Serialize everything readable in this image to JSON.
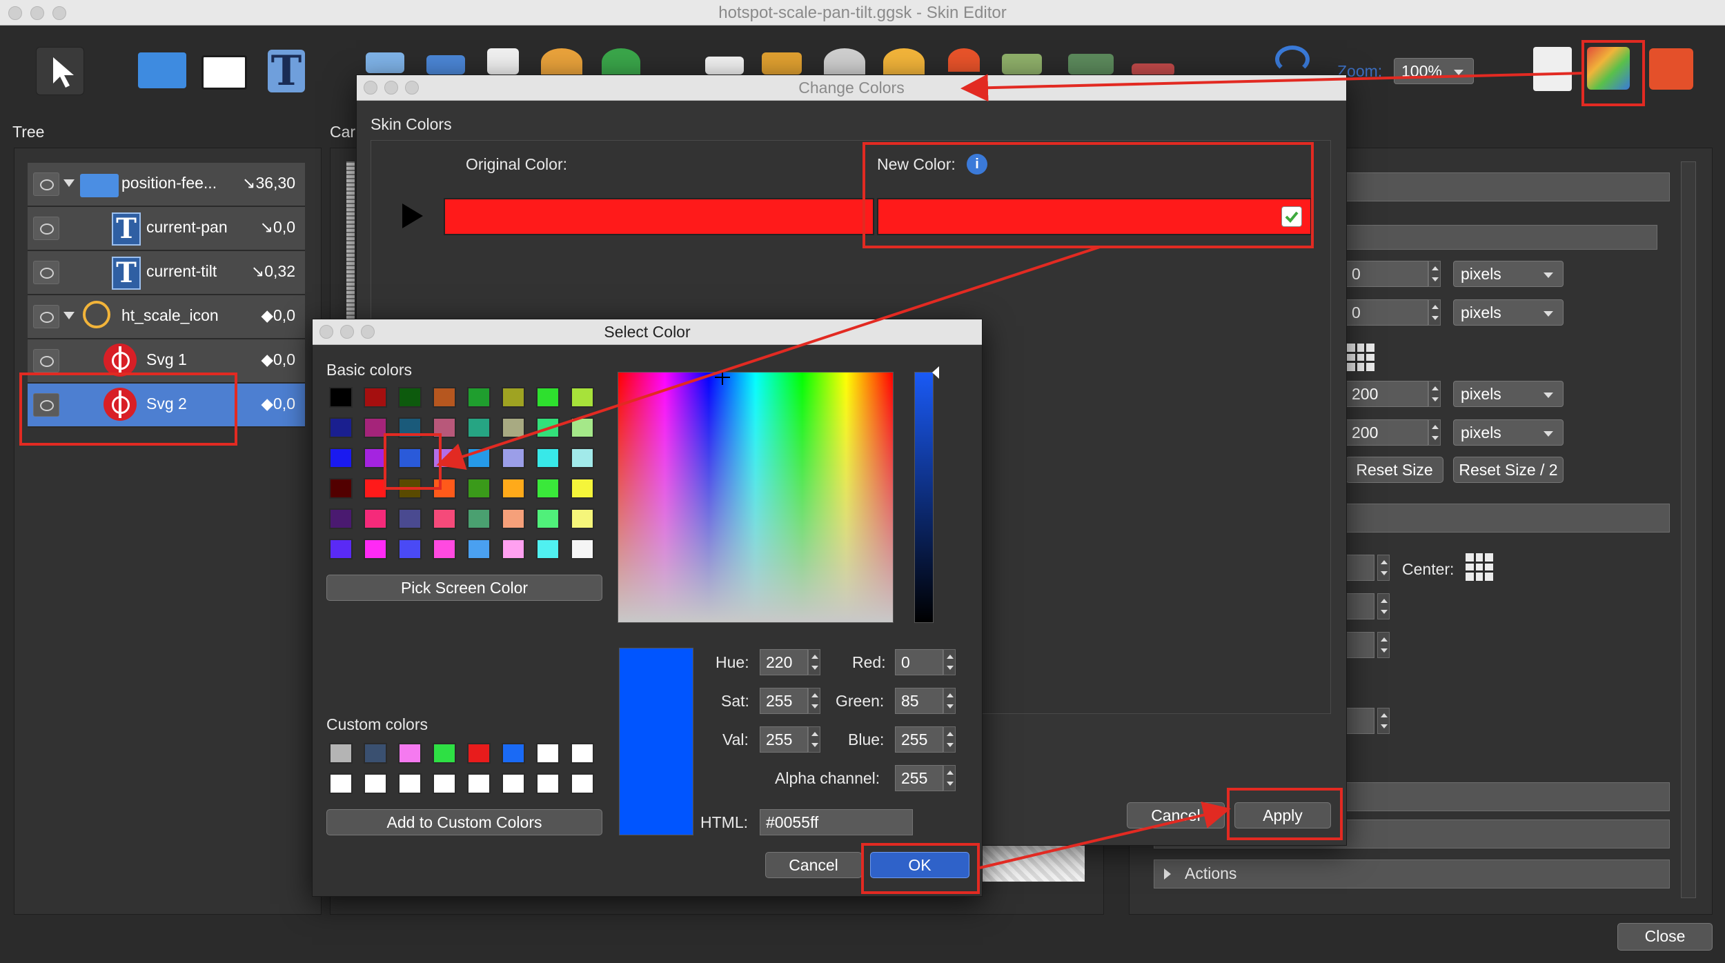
{
  "window": {
    "title": "hotspot-scale-pan-tilt.ggsk - Skin Editor"
  },
  "toolbar": {
    "zoom_label": "Zoom:",
    "zoom_value": "100%"
  },
  "tree": {
    "title": "Tree",
    "nodes": [
      {
        "label": "position-fee...",
        "value": "↘36,30"
      },
      {
        "label": "current-pan",
        "value": "↘0,0"
      },
      {
        "label": "current-tilt",
        "value": "↘0,32"
      },
      {
        "label": "ht_scale_icon",
        "value": "◆0,0"
      },
      {
        "label": "Svg 1",
        "value": "◆0,0"
      },
      {
        "label": "Svg 2",
        "value": "◆0,0"
      }
    ]
  },
  "canvas": {
    "title_partial": "Car"
  },
  "properties": {
    "x_value": "0",
    "y_value": "0",
    "width_value": "200",
    "height_value": "200",
    "unit": "pixels",
    "reset_size": "Reset Size",
    "reset_size_half": "Reset Size / 2",
    "center_label": "Center:",
    "actions_label": "Actions",
    "close": "Close"
  },
  "change_colors": {
    "title": "Change Colors",
    "group": "Skin Colors",
    "original_label": "Original Color:",
    "new_label": "New Color:",
    "original_color": "#ff1a1a",
    "new_color": "#ff1a1a",
    "cancel": "Cancel",
    "apply": "Apply"
  },
  "select_color": {
    "title": "Select Color",
    "basic_label": "Basic colors",
    "basic_colors": [
      "#000000",
      "#a50f0f",
      "#0d5a0d",
      "#b6571f",
      "#1f9e2e",
      "#9fa322",
      "#2ee02e",
      "#a7e23a",
      "#1a1f8f",
      "#a5247a",
      "#1a5a7a",
      "#b8587a",
      "#26a583",
      "#a8aa82",
      "#33e07a",
      "#a5e889",
      "#1a1af0",
      "#a424e0",
      "#2a5ad9",
      "#b36ee8",
      "#269ae8",
      "#9b9ee8",
      "#38e8e8",
      "#a2eaea",
      "#520000",
      "#ff1a1a",
      "#5a4a00",
      "#ff5a1a",
      "#3a9a1a",
      "#ffaa1a",
      "#3ae83a",
      "#f5f53a",
      "#4a1a70",
      "#f52a7a",
      "#4a4a90",
      "#f54a7a",
      "#4aa070",
      "#f5a07a",
      "#50f07a",
      "#f5f57a",
      "#5a2af5",
      "#ff2af5",
      "#4a4af5",
      "#ff4ae0",
      "#4aa0f0",
      "#ffa0f0",
      "#50f0f0",
      "#f5f5f5"
    ],
    "pick_screen": "Pick Screen Color",
    "custom_label": "Custom colors",
    "custom_colors": [
      "#b4b4b4",
      "#3a5070",
      "#f57af0",
      "#2ee044",
      "#e81c1c",
      "#1a6af5",
      "#ffffff",
      "#ffffff",
      "#ffffff",
      "#ffffff",
      "#ffffff",
      "#ffffff",
      "#ffffff",
      "#ffffff",
      "#ffffff",
      "#ffffff"
    ],
    "add_custom": "Add to Custom Colors",
    "hue_label": "Hue:",
    "hue": "220",
    "sat_label": "Sat:",
    "sat": "255",
    "val_label": "Val:",
    "val": "255",
    "red_label": "Red:",
    "red": "0",
    "green_label": "Green:",
    "green": "85",
    "blue_label": "Blue:",
    "blue": "255",
    "alpha_label": "Alpha channel:",
    "alpha": "255",
    "html_label": "HTML:",
    "html": "#0055ff",
    "preview_color": "#0055ff",
    "cancel": "Cancel",
    "ok": "OK"
  },
  "annotation_color": "#e22a22"
}
